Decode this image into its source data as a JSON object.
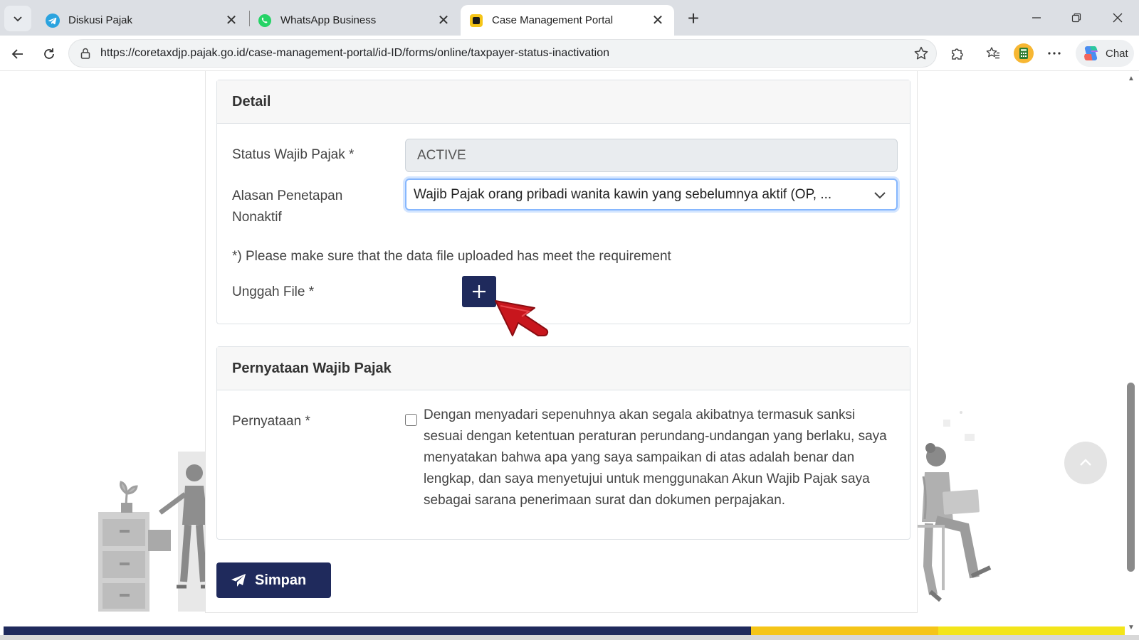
{
  "browser": {
    "tabs": [
      {
        "label": "Diskusi Pajak",
        "icon": "telegram-icon",
        "active": false
      },
      {
        "label": "WhatsApp Business",
        "icon": "whatsapp-icon",
        "active": false
      },
      {
        "label": "Case Management Portal",
        "icon": "portal-icon",
        "active": true
      }
    ],
    "url": "https://coretaxdjp.pajak.go.id/case-management-portal/id-ID/forms/online/taxpayer-status-inactivation",
    "chat_label": "Chat"
  },
  "detail": {
    "header": "Detail",
    "status_label": "Status Wajib Pajak *",
    "status_value": "ACTIVE",
    "reason_label_line1": "Alasan Penetapan",
    "reason_label_line2": "Nonaktif",
    "reason_value": "Wajib Pajak orang pribadi wanita kawin yang sebelumnya aktif (OP, ...",
    "note": "*) Please make sure that the data file uploaded has meet the requirement",
    "upload_label": "Unggah File *"
  },
  "statement": {
    "header": "Pernyataan Wajib Pajak",
    "label": "Pernyataan *",
    "checked": false,
    "text": "Dengan menyadari sepenuhnya akan segala akibatnya termasuk sanksi sesuai dengan ketentuan peraturan perundang-undangan yang berlaku, saya menyatakan bahwa apa yang saya sampaikan di atas adalah benar dan lengkap, dan saya menyetujui untuk menggunakan Akun Wajib Pajak saya sebagai sarana penerimaan surat dan dokumen perpajakan."
  },
  "actions": {
    "save_label": "Simpan"
  },
  "colors": {
    "primary": "#1f2a5c",
    "focus_border": "#86b7fe",
    "footer_gold": "#f5c518",
    "footer_yellow": "#f3e51a",
    "pointer_red": "#c8161d"
  }
}
